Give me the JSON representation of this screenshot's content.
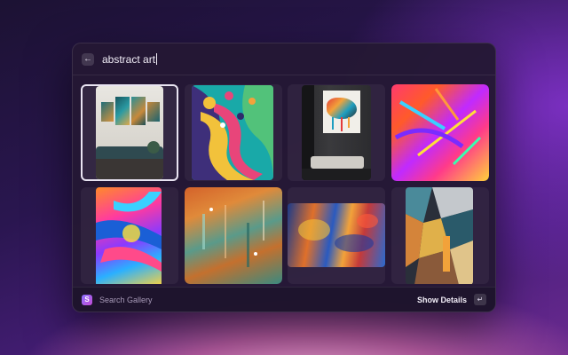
{
  "search": {
    "query": "abstract art",
    "back_icon": "arrow-left-icon"
  },
  "gallery": {
    "items": [
      {
        "name": "living-room-triptych",
        "selected": true
      },
      {
        "name": "colorful-swirls",
        "selected": false
      },
      {
        "name": "drip-painting-room",
        "selected": false
      },
      {
        "name": "neon-brushstrokes",
        "selected": false
      },
      {
        "name": "paint-explosion",
        "selected": false
      },
      {
        "name": "orange-teal-abstract",
        "selected": false
      },
      {
        "name": "blue-orange-landscape",
        "selected": false
      },
      {
        "name": "cubist-geometric",
        "selected": false
      }
    ]
  },
  "footer": {
    "label": "Search Gallery",
    "action": "Show Details",
    "enter_key": "↵",
    "logo_letter": "S"
  },
  "colors": {
    "accent": "#8a72ff",
    "window_bg": "#241834"
  }
}
